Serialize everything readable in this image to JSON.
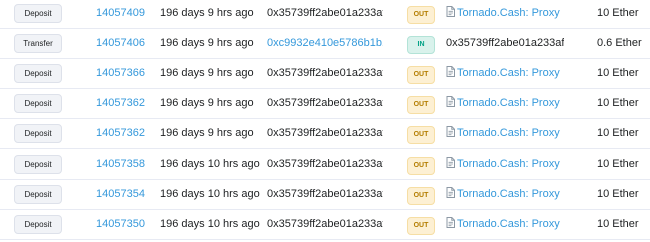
{
  "rows": [
    {
      "method": "Deposit",
      "block": "14057409",
      "age": "196 days 9 hrs ago",
      "from": "0x35739ff2abe01a233af...",
      "from_is_link": false,
      "direction": "OUT",
      "to": "Tornado.Cash: Proxy",
      "to_is_contract": true,
      "value": "10 Ether"
    },
    {
      "method": "Transfer",
      "block": "14057406",
      "age": "196 days 9 hrs ago",
      "from": "0xc9932e410e5786b1b1...",
      "from_is_link": true,
      "direction": "IN",
      "to": "0x35739ff2abe01a233af...",
      "to_is_contract": false,
      "value": "0.6 Ether"
    },
    {
      "method": "Deposit",
      "block": "14057366",
      "age": "196 days 9 hrs ago",
      "from": "0x35739ff2abe01a233af...",
      "from_is_link": false,
      "direction": "OUT",
      "to": "Tornado.Cash: Proxy",
      "to_is_contract": true,
      "value": "10 Ether"
    },
    {
      "method": "Deposit",
      "block": "14057362",
      "age": "196 days 9 hrs ago",
      "from": "0x35739ff2abe01a233af...",
      "from_is_link": false,
      "direction": "OUT",
      "to": "Tornado.Cash: Proxy",
      "to_is_contract": true,
      "value": "10 Ether"
    },
    {
      "method": "Deposit",
      "block": "14057362",
      "age": "196 days 9 hrs ago",
      "from": "0x35739ff2abe01a233af...",
      "from_is_link": false,
      "direction": "OUT",
      "to": "Tornado.Cash: Proxy",
      "to_is_contract": true,
      "value": "10 Ether"
    },
    {
      "method": "Deposit",
      "block": "14057358",
      "age": "196 days 10 hrs ago",
      "from": "0x35739ff2abe01a233af...",
      "from_is_link": false,
      "direction": "OUT",
      "to": "Tornado.Cash: Proxy",
      "to_is_contract": true,
      "value": "10 Ether"
    },
    {
      "method": "Deposit",
      "block": "14057354",
      "age": "196 days 10 hrs ago",
      "from": "0x35739ff2abe01a233af...",
      "from_is_link": false,
      "direction": "OUT",
      "to": "Tornado.Cash: Proxy",
      "to_is_contract": true,
      "value": "10 Ether"
    },
    {
      "method": "Deposit",
      "block": "14057350",
      "age": "196 days 10 hrs ago",
      "from": "0x35739ff2abe01a233af...",
      "from_is_link": false,
      "direction": "OUT",
      "to": "Tornado.Cash: Proxy",
      "to_is_contract": true,
      "value": "10 Ether"
    }
  ],
  "icons": {
    "contract": "document-icon"
  },
  "colors": {
    "link": "#3498db",
    "out_badge_text": "#b47d00",
    "out_badge_bg": "#fdf0d3",
    "in_badge_text": "#00a186",
    "in_badge_bg": "#d9f2ec"
  }
}
